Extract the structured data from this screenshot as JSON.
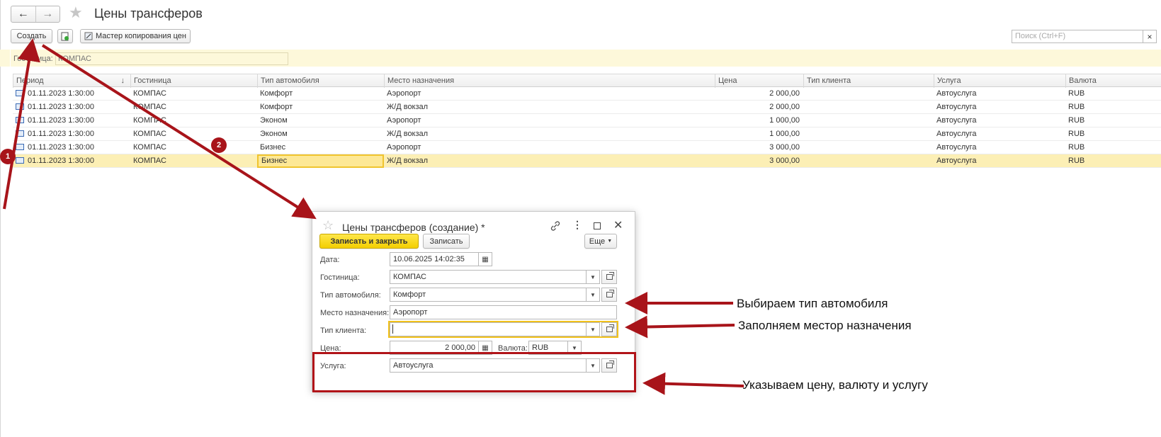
{
  "nav": {
    "back_icon": "arrow-left-icon",
    "forward_icon": "arrow-right-icon"
  },
  "header": {
    "title": "Цены трансферов"
  },
  "toolbar": {
    "create_label": "Создать",
    "copy_master_label": "Мастер копирования цен",
    "search_placeholder": "Поиск (Ctrl+F)",
    "search_clear": "×"
  },
  "filter": {
    "label": "Гостиница:",
    "value": "КОМПАС"
  },
  "table": {
    "columns": [
      "Период",
      "Гостиница",
      "Тип автомобиля",
      "Место назначения",
      "Цена",
      "Тип клиента",
      "Услуга",
      "Валюта"
    ],
    "sort_indicator": "↓",
    "rows": [
      [
        "01.11.2023 1:30:00",
        "КОМПАС",
        "Комфорт",
        "Аэропорт",
        "2 000,00",
        "",
        "Автоуслуга",
        "RUB"
      ],
      [
        "01.11.2023 1:30:00",
        "КОМПАС",
        "Комфорт",
        "Ж/Д вокзал",
        "2 000,00",
        "",
        "Автоуслуга",
        "RUB"
      ],
      [
        "01.11.2023 1:30:00",
        "КОМПАС",
        "Эконом",
        "Аэропорт",
        "1 000,00",
        "",
        "Автоуслуга",
        "RUB"
      ],
      [
        "01.11.2023 1:30:00",
        "КОМПАС",
        "Эконом",
        "Ж/Д вокзал",
        "1 000,00",
        "",
        "Автоуслуга",
        "RUB"
      ],
      [
        "01.11.2023 1:30:00",
        "КОМПАС",
        "Бизнес",
        "Аэропорт",
        "3 000,00",
        "",
        "Автоуслуга",
        "RUB"
      ],
      [
        "01.11.2023 1:30:00",
        "КОМПАС",
        "Бизнес",
        "Ж/Д вокзал",
        "3 000,00",
        "",
        "Автоуслуга",
        "RUB"
      ]
    ],
    "selected_row": 5
  },
  "dialog": {
    "title": "Цены трансферов (создание) *",
    "save_close_label": "Записать и закрыть",
    "save_label": "Записать",
    "more_label": "Еще",
    "fields": {
      "date_label": "Дата:",
      "date_value": "10.06.2025 14:02:35",
      "hotel_label": "Гостиница:",
      "hotel_value": "КОМПАС",
      "car_type_label": "Тип автомобиля:",
      "car_type_value": "Комфорт",
      "destination_label": "Место назначения:",
      "destination_value": "Аэропорт",
      "client_type_label": "Тип клиента:",
      "client_type_value": "",
      "price_label": "Цена:",
      "price_value": "2 000,00",
      "currency_label": "Валюта:",
      "currency_value": "RUB",
      "service_label": "Услуга:",
      "service_value": "Автоуслуга"
    }
  },
  "annotations": {
    "badge1": "1",
    "badge2": "2",
    "note_car": "Выбираем тип автомобиля",
    "note_destination": "Заполняем местор назначения",
    "note_price": "Указываем цену, валюту и услугу"
  },
  "colors": {
    "annotation_red": "#a8141a",
    "primary_yellow": "#f7d816",
    "selection": "#fcefb5"
  }
}
